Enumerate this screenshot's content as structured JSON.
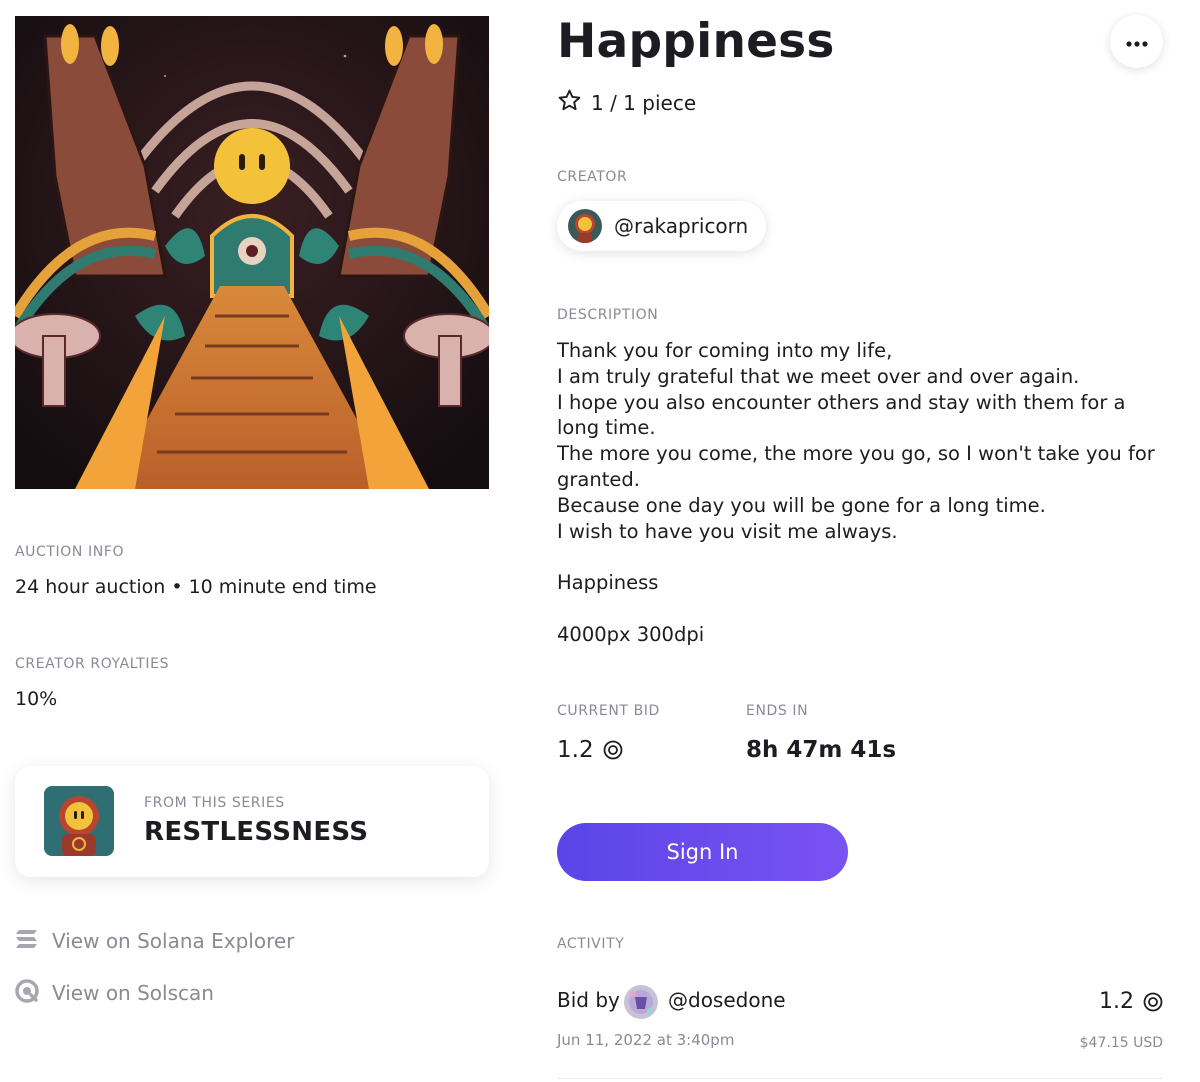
{
  "artwork": {
    "name": "artwork-image"
  },
  "title": "Happiness",
  "edition": {
    "text": "1 / 1 piece",
    "icon": "star-icon"
  },
  "creator": {
    "label": "CREATOR",
    "handle": "@rakapricorn"
  },
  "description": {
    "label": "DESCRIPTION",
    "lines": [
      "Thank you for coming into my life,",
      "I am truly grateful that we meet over and over again.",
      "I hope you also encounter others and stay with them for a long time.",
      "The more you come, the more you go, so I won't take you for granted.",
      "Because one day you will be gone for a long time.",
      "I wish to have you visit me always."
    ],
    "name_line": "Happiness",
    "specs_line": "4000px 300dpi"
  },
  "auction": {
    "label": "AUCTION INFO",
    "value": "24 hour auction • 10 minute end time"
  },
  "royalties": {
    "label": "CREATOR ROYALTIES",
    "value": "10%"
  },
  "series": {
    "label": "FROM THIS SERIES",
    "name": "RESTLESSNESS"
  },
  "links": {
    "explorer": "View on Solana Explorer",
    "solscan": "View on Solscan"
  },
  "bid": {
    "label": "CURRENT BID",
    "value": "1.2",
    "currency_icon": "sol-icon"
  },
  "ends": {
    "label": "ENDS IN",
    "value": "8h 47m 41s"
  },
  "signin_label": "Sign In",
  "activity": {
    "label": "ACTIVITY",
    "items": [
      {
        "prefix": "Bid by",
        "user": "@dosedone",
        "date": "Jun 11, 2022 at 3:40pm",
        "amount": "1.2",
        "usd": "$47.15 USD"
      }
    ]
  },
  "colors": {
    "accent_start": "#5a45e8",
    "accent_end": "#7a52f2",
    "muted_text": "#8a8a96",
    "text": "#1c1c22"
  }
}
